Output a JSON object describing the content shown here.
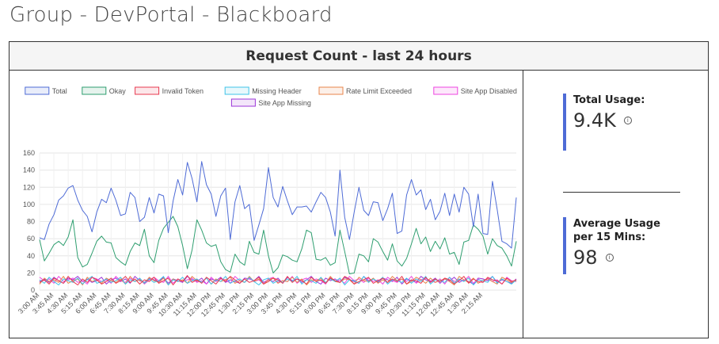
{
  "page": {
    "title": "Group - DevPortal - Blackboard"
  },
  "panel": {
    "title": "Request Count - last 24 hours"
  },
  "stats": {
    "total_usage_label": "Total Usage:",
    "total_usage_value": "9.4K",
    "avg_usage_label": "Average Usage per 15 Mins:",
    "avg_usage_value": "98",
    "info_icon": "info-icon"
  },
  "colors": {
    "accent": "#4e6bd6",
    "Total": "#4e6bd6",
    "Okay": "#2e9e6f",
    "Invalid Token": "#e8384f",
    "Missing Header": "#3fc3e8",
    "Rate Limit Exceeded": "#e8844a",
    "Site App Disabled": "#ee45e0",
    "Site App Missing": "#9b35d8"
  },
  "chart_data": {
    "type": "line",
    "title": "",
    "xlabel": "",
    "ylabel": "",
    "ylim": [
      0,
      160
    ],
    "yticks": [
      0,
      20,
      40,
      60,
      80,
      100,
      120,
      140,
      160
    ],
    "grid": true,
    "legend_placement": "top",
    "x_tick_labels": [
      "3:00 AM",
      "3:45 AM",
      "4:30 AM",
      "5:15 AM",
      "6:00 AM",
      "6:45 AM",
      "7:30 AM",
      "8:15 AM",
      "9:00 AM",
      "9:45 AM",
      "10:30 AM",
      "11:15 AM",
      "12:00 PM",
      "12:45 PM",
      "1:30 PM",
      "2:15 PM",
      "3:00 PM",
      "3:45 PM",
      "4:30 PM",
      "5:15 PM",
      "6:00 PM",
      "6:45 PM",
      "7:30 PM",
      "8:15 PM",
      "9:00 PM",
      "9:45 PM",
      "10:30 PM",
      "11:15 PM",
      "12:00 AM",
      "12:45 AM",
      "1:30 AM",
      "2:15 AM"
    ],
    "series": [
      {
        "name": "Total",
        "values": [
          61,
          59,
          77,
          88,
          105,
          110,
          119,
          122,
          105,
          93,
          86,
          68,
          91,
          106,
          102,
          119,
          105,
          87,
          89,
          114,
          108,
          80,
          85,
          108,
          90,
          112,
          110,
          67,
          104,
          129,
          111,
          149,
          130,
          103,
          150,
          123,
          112,
          86,
          110,
          119,
          59,
          103,
          122,
          95,
          100,
          58,
          76,
          95,
          143,
          108,
          97,
          121,
          104,
          88,
          97,
          97,
          98,
          91,
          103,
          114,
          108,
          91,
          63,
          140,
          85,
          59,
          91,
          120,
          93,
          87,
          103,
          102,
          81,
          95,
          113,
          66,
          69,
          111,
          129,
          111,
          117,
          94,
          106,
          82,
          92,
          113,
          87,
          112,
          91,
          120,
          112,
          74,
          112,
          66,
          65,
          127,
          94,
          57,
          54,
          49,
          108
        ]
      },
      {
        "name": "Okay",
        "values": [
          59,
          34,
          43,
          53,
          57,
          52,
          62,
          82,
          38,
          27,
          30,
          43,
          57,
          63,
          56,
          55,
          38,
          33,
          29,
          45,
          55,
          52,
          71,
          40,
          32,
          58,
          72,
          79,
          86,
          74,
          52,
          25,
          47,
          82,
          70,
          55,
          51,
          53,
          33,
          24,
          21,
          42,
          33,
          29,
          57,
          44,
          42,
          70,
          40,
          20,
          26,
          41,
          39,
          35,
          33,
          48,
          70,
          67,
          36,
          35,
          38,
          29,
          32,
          70,
          45,
          19,
          20,
          42,
          40,
          33,
          60,
          56,
          45,
          35,
          54,
          34,
          28,
          37,
          54,
          72,
          54,
          62,
          45,
          57,
          48,
          61,
          42,
          44,
          30,
          56,
          58,
          76,
          71,
          63,
          42,
          60,
          52,
          49,
          40,
          28,
          57
        ]
      },
      {
        "name": "Invalid Token",
        "values": [
          9,
          12,
          7,
          14,
          11,
          8,
          16,
          10,
          6,
          13,
          9,
          15,
          12,
          7,
          10,
          14,
          8,
          11,
          16,
          9,
          13,
          7,
          12,
          10,
          15,
          8,
          11,
          14,
          6,
          13,
          10,
          17,
          9,
          12,
          8,
          15,
          11,
          7,
          14,
          10,
          16,
          12,
          8,
          13,
          9,
          11,
          15,
          7,
          10,
          14,
          12,
          8,
          16,
          9,
          13,
          11,
          7,
          15,
          10,
          12,
          8,
          14,
          11,
          9,
          16,
          13,
          7,
          10,
          12,
          15,
          8,
          11,
          14,
          9,
          13,
          10,
          16,
          7,
          12,
          11,
          8,
          15,
          9,
          13,
          10,
          14,
          12,
          7,
          11,
          16,
          8,
          13,
          10,
          9,
          15,
          12,
          11,
          7,
          14,
          10,
          12
        ]
      },
      {
        "name": "Missing Header",
        "values": [
          12,
          8,
          15,
          10,
          6,
          13,
          11,
          9,
          14,
          7,
          12,
          16,
          8,
          10,
          13,
          9,
          11,
          15,
          7,
          12,
          10,
          14,
          8,
          13,
          9,
          11,
          16,
          6,
          12,
          10,
          15,
          8,
          11,
          13,
          9,
          14,
          7,
          12,
          10,
          16,
          8,
          11,
          13,
          9,
          15,
          10,
          6,
          12,
          14,
          8,
          11,
          9,
          13,
          10,
          16,
          7,
          12,
          11,
          8,
          15,
          9,
          13,
          10,
          14,
          6,
          12,
          11,
          8,
          16,
          9,
          13,
          10,
          15,
          7,
          12,
          11,
          9,
          14,
          8,
          13,
          10,
          16,
          7,
          12,
          11,
          9,
          15,
          8,
          13,
          10,
          14,
          6,
          12,
          11,
          9,
          16,
          8,
          13,
          10,
          7,
          12
        ]
      },
      {
        "name": "Rate Limit Exceeded",
        "values": [
          7,
          14,
          10,
          12,
          9,
          16,
          8,
          11,
          13,
          6,
          15,
          10,
          12,
          8,
          14,
          11,
          9,
          13,
          7,
          16,
          10,
          12,
          8,
          15,
          11,
          9,
          14,
          6,
          13,
          10,
          12,
          8,
          16,
          11,
          9,
          14,
          7,
          13,
          10,
          12,
          15,
          8,
          11,
          9,
          16,
          10,
          13,
          7,
          12,
          14,
          8,
          11,
          10,
          15,
          9,
          13,
          6,
          12,
          11,
          14,
          8,
          16,
          10,
          9,
          13,
          12,
          7,
          15,
          11,
          10,
          14,
          8,
          12,
          9,
          16,
          11,
          13,
          7,
          10,
          15,
          12,
          8,
          14,
          9,
          11,
          13,
          10,
          6,
          16,
          12,
          9,
          14,
          8,
          11,
          13,
          10,
          7,
          15,
          12,
          9,
          11
        ]
      },
      {
        "name": "Site App Disabled",
        "values": [
          15,
          11,
          13,
          8,
          16,
          10,
          12,
          14,
          9,
          11,
          7,
          15,
          13,
          10,
          12,
          8,
          16,
          11,
          9,
          14,
          10,
          13,
          7,
          12,
          15,
          11,
          9,
          16,
          8,
          13,
          10,
          12,
          14,
          9,
          11,
          7,
          15,
          10,
          13,
          12,
          8,
          16,
          11,
          9,
          14,
          10,
          12,
          7,
          13,
          15,
          9,
          11,
          10,
          16,
          8,
          12,
          14,
          9,
          13,
          11,
          7,
          15,
          10,
          12,
          8,
          16,
          11,
          13,
          9,
          14,
          10,
          12,
          7,
          15,
          11,
          9,
          13,
          10,
          16,
          8,
          12,
          14,
          11,
          9,
          13,
          7,
          15,
          10,
          12,
          11,
          16,
          8,
          13,
          9,
          14,
          10,
          12,
          7,
          15,
          11,
          10
        ]
      },
      {
        "name": "Site App Missing",
        "values": [
          10,
          13,
          9,
          15,
          11,
          8,
          14,
          12,
          16,
          10,
          13,
          9,
          11,
          15,
          7,
          12,
          14,
          10,
          13,
          8,
          16,
          11,
          9,
          14,
          12,
          10,
          15,
          8,
          13,
          11,
          9,
          16,
          12,
          10,
          14,
          7,
          13,
          11,
          15,
          9,
          12,
          10,
          8,
          14,
          13,
          11,
          16,
          9,
          12,
          10,
          14,
          8,
          15,
          11,
          13,
          9,
          12,
          16,
          10,
          7,
          14,
          11,
          13,
          9,
          15,
          12,
          10,
          8,
          16,
          11,
          13,
          9,
          14,
          12,
          10,
          15,
          7,
          13,
          11,
          9,
          16,
          12,
          10,
          14,
          8,
          13,
          11,
          15,
          9,
          12,
          10,
          7,
          14,
          13,
          11,
          16,
          9,
          12,
          10,
          8,
          13
        ]
      }
    ]
  }
}
